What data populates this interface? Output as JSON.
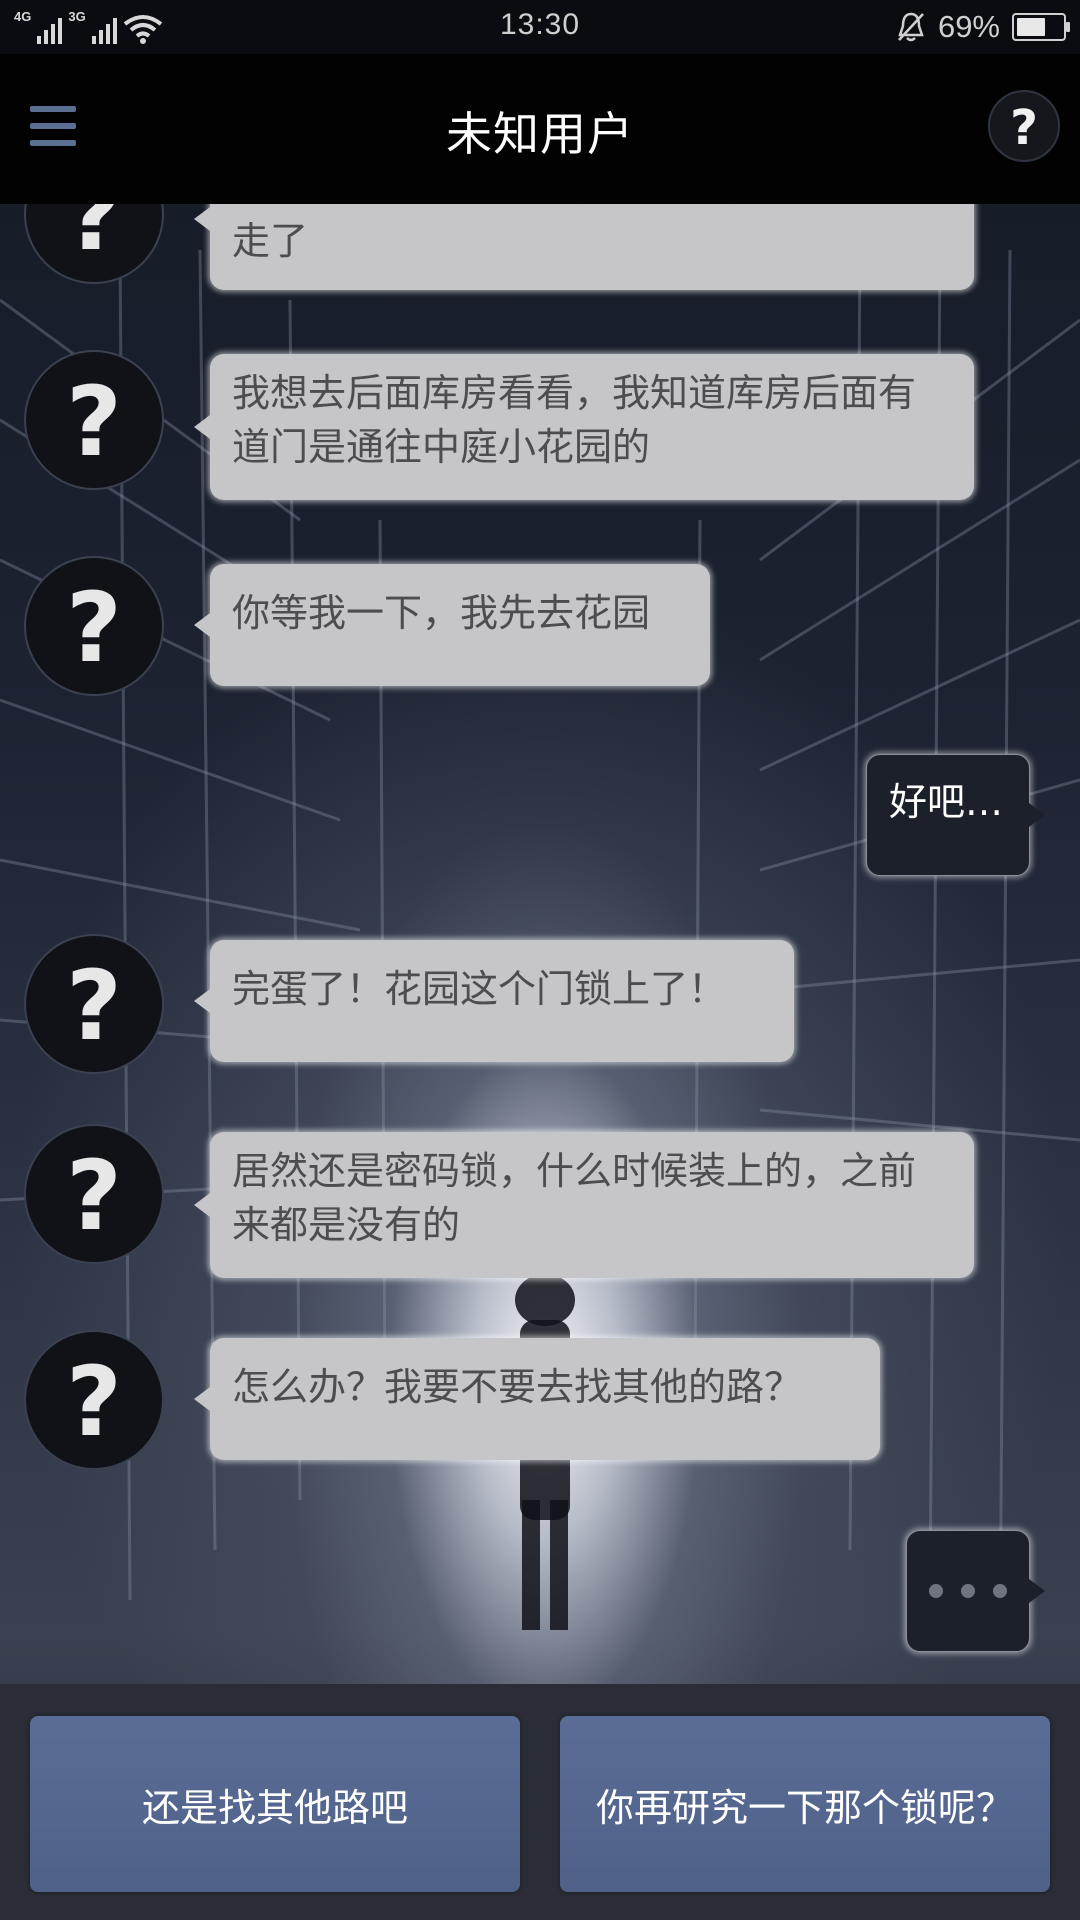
{
  "status_bar": {
    "network_1": "4G",
    "network_2": "3G",
    "time": "13:30",
    "battery_percent": "69%",
    "battery_level": 0.69,
    "icons": [
      "signal-4g-icon",
      "signal-3g-icon",
      "wifi-icon",
      "bell-muted-icon",
      "battery-icon"
    ]
  },
  "header": {
    "title": "未知用户",
    "menu_icon": "hamburger-menu-icon",
    "help_label": "?"
  },
  "avatar_glyph": "?",
  "messages": [
    {
      "from": "contact",
      "text": "几个展厅我都找遍了，都没有，肯定是移走了"
    },
    {
      "from": "contact",
      "text": "我想去后面库房看看，我知道库房后面有道门是通往中庭小花园的"
    },
    {
      "from": "contact",
      "text": "你等我一下，我先去花园"
    },
    {
      "from": "me",
      "text": "好吧…"
    },
    {
      "from": "contact",
      "text": "完蛋了！花园这个门锁上了！"
    },
    {
      "from": "contact",
      "text": "居然还是密码锁，什么时候装上的，之前来都是没有的"
    },
    {
      "from": "contact",
      "text": "怎么办？我要不要去找其他的路？"
    },
    {
      "from": "me",
      "text": "",
      "typing": true
    }
  ],
  "choices": [
    {
      "label": "还是找其他路吧"
    },
    {
      "label": "你再研究一下那个锁呢？"
    }
  ],
  "colors": {
    "bubble_in": "#c6c6c8",
    "bubble_out": "#1c202a",
    "choice_button": "#5a6d96",
    "menu_icon": "#5b6f93"
  }
}
